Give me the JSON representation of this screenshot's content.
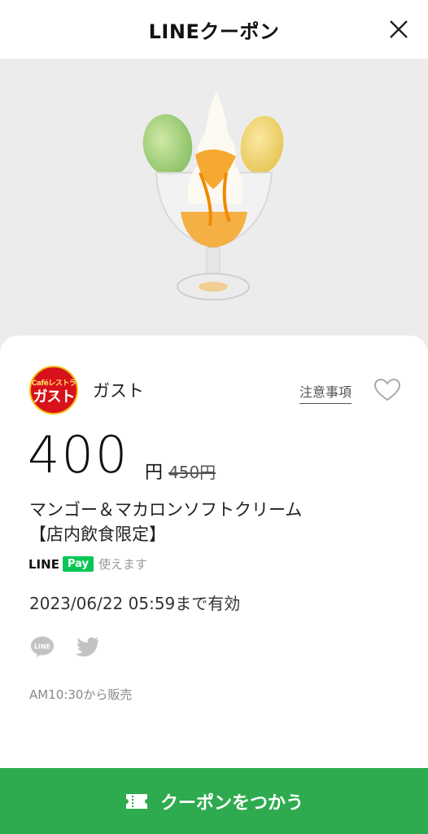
{
  "header": {
    "title": "LINEクーポン"
  },
  "store": {
    "logo_small": "Caféレストラン",
    "logo_main": "ガスト",
    "name": "ガスト",
    "notes_label": "注意事項"
  },
  "coupon": {
    "price": "400",
    "price_unit": "円",
    "original_price": "450円",
    "title_line1": "マンゴー＆マカロンソフトクリーム",
    "title_line2": "【店内飲食限定】",
    "linepay_line": "LINE",
    "linepay_pay": "Pay",
    "linepay_text": "使えます",
    "validity": "2023/06/22 05:59まで有効",
    "sale_time": "AM10:30から販売"
  },
  "share": {
    "icons": [
      "line-share-icon",
      "twitter-icon"
    ]
  },
  "action": {
    "use_label": "クーポンをつかう"
  },
  "colors": {
    "primary_green": "#2eab4f",
    "linepay_green": "#06c755",
    "brand_red": "#d8121a"
  }
}
